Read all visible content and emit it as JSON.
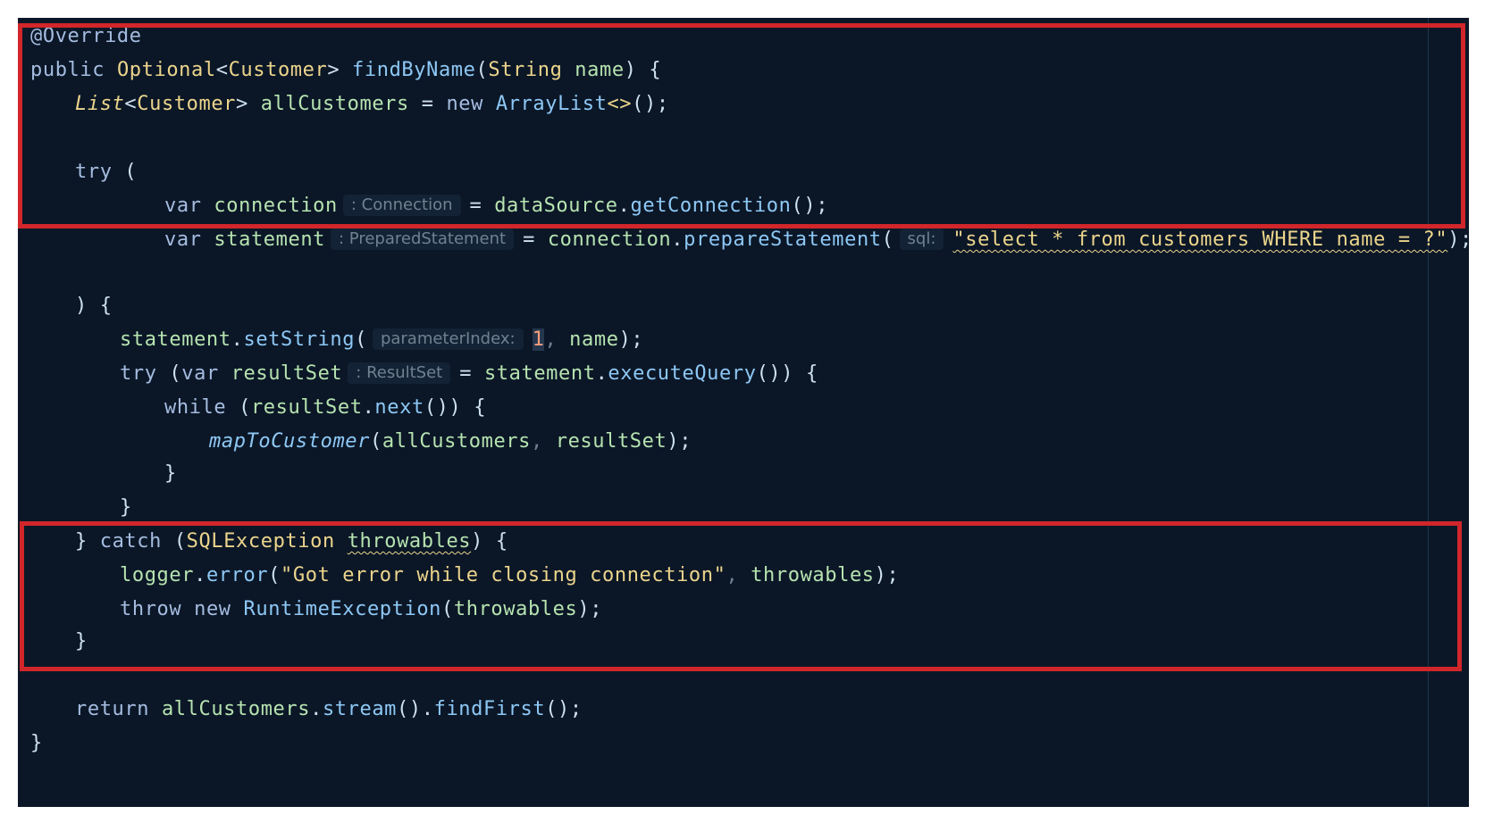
{
  "code": {
    "l1": {
      "annotation": "@Override"
    },
    "l2": {
      "public": "public",
      "optional": "Optional",
      "lt": "<",
      "customer": "Customer",
      "gt": ">",
      "method": "findByName",
      "open": "(",
      "string": "String",
      "param": "name",
      "close": ") {"
    },
    "l3": {
      "list": "List",
      "lt": "<",
      "customer": "Customer",
      "gt": ">",
      "var": "allCustomers",
      "eq": " = ",
      "new": "new",
      "arraylist": "ArrayList",
      "diamond": "<>",
      "end": "();"
    },
    "l5": {
      "try": "try",
      "open": "("
    },
    "l6": {
      "var": "var",
      "name": "connection",
      "hint": ": Connection",
      "eq": "= ",
      "ds": "dataSource",
      "dot": ".",
      "method": "getConnection",
      "end": "();"
    },
    "l7": {
      "var": "var",
      "name": "statement",
      "hint": ": PreparedStatement",
      "eq": "= ",
      "conn": "connection",
      "dot": ".",
      "method": "prepareStatement",
      "open": "(",
      "hint2": "sql:",
      "sql": "\"select * from customers WHERE name = ?\"",
      "end": ");"
    },
    "l9": {
      "close": ") {"
    },
    "l10": {
      "stmt": "statement",
      "dot": ".",
      "method": "setString",
      "open": "(",
      "hint": "parameterIndex:",
      "num": "1",
      "comma": ",",
      "name": "name",
      "end": ");"
    },
    "l11": {
      "try": "try",
      "open": "(",
      "var": "var",
      "name": "resultSet",
      "hint": ": ResultSet",
      "eq": "= ",
      "stmt": "statement",
      "dot": ".",
      "method": "executeQuery",
      "end": "()) {"
    },
    "l12": {
      "while": "while",
      "open": "(",
      "rs": "resultSet",
      "dot": ".",
      "method": "next",
      "end": "()) {"
    },
    "l13": {
      "method": "mapToCustomer",
      "open": "(",
      "arg1": "allCustomers",
      "comma": ",",
      "arg2": "resultSet",
      "end": ");"
    },
    "l14": {
      "brace": "}"
    },
    "l15": {
      "brace": "}"
    },
    "l16": {
      "brace": "}",
      "catch": "catch",
      "open": "(",
      "type": "SQLException",
      "var": "throwables",
      "end": ") {"
    },
    "l17": {
      "logger": "logger",
      "dot": ".",
      "method": "error",
      "open": "(",
      "msg": "\"Got error while closing connection\"",
      "comma": ",",
      "arg": "throwables",
      "end": ");"
    },
    "l18": {
      "throw": "throw",
      "new": "new",
      "type": "RuntimeException",
      "open": "(",
      "arg": "throwables",
      "end": ");"
    },
    "l19": {
      "brace": "}"
    },
    "l21": {
      "return": "return",
      "var": "allCustomers",
      "dot1": ".",
      "m1": "stream",
      "mid": "()",
      "dot2": ".",
      "m2": "findFirst",
      "end": "();"
    },
    "l22": {
      "brace": "}"
    }
  },
  "highlight_color": "#d1262a"
}
